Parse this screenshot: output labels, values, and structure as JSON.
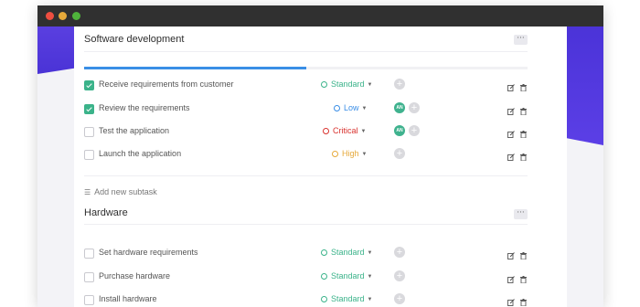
{
  "colors": {
    "accent_purple": "#4f38dc",
    "progress_blue": "#3a8ee6",
    "check_green": "#3bb38a",
    "avatar_green": "#3fb28e",
    "standard": "#3bb38a",
    "low": "#3a8ee6",
    "critical": "#d9322e",
    "high": "#e6a93a"
  },
  "sections": [
    {
      "title": "Software development",
      "more_label": "···",
      "progress": 0.5,
      "add_subtask_label": "Add new subtask",
      "tasks": [
        {
          "name": "Receive requirements from customer",
          "checked": true,
          "priority": "Standard",
          "assignee": ""
        },
        {
          "name": "Review the requirements",
          "checked": true,
          "priority": "Low",
          "assignee": "AN"
        },
        {
          "name": "Test the application",
          "checked": false,
          "priority": "Critical",
          "assignee": "AN"
        },
        {
          "name": "Launch the application",
          "checked": false,
          "priority": "High",
          "assignee": ""
        }
      ]
    },
    {
      "title": "Hardware",
      "more_label": "···",
      "tasks": [
        {
          "name": "Set hardware requirements",
          "checked": false,
          "priority": "Standard",
          "assignee": ""
        },
        {
          "name": "Purchase hardware",
          "checked": false,
          "priority": "Standard",
          "assignee": ""
        },
        {
          "name": "Install hardware",
          "checked": false,
          "priority": "Standard",
          "assignee": ""
        }
      ]
    }
  ],
  "icons": {
    "edit": "edit-icon",
    "delete": "trash-icon",
    "add_assignee": "plus-icon",
    "add_subtask": "list-icon"
  }
}
